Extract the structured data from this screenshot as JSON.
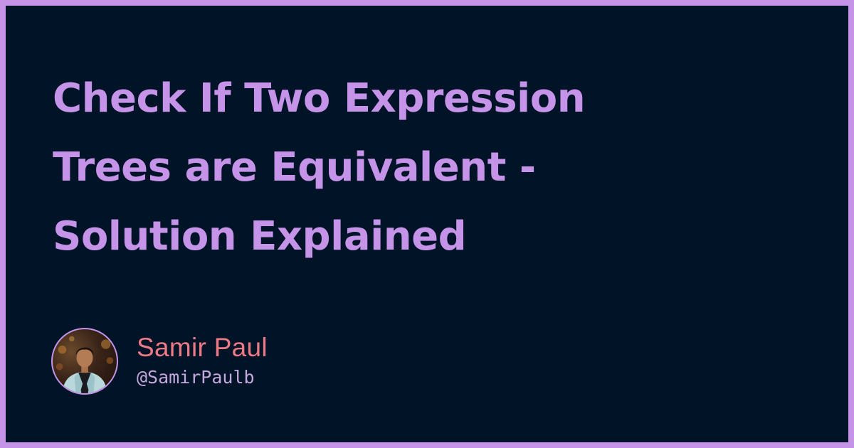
{
  "card": {
    "title_lines": [
      "Check If Two Expression",
      "Trees are Equivalent -",
      "Solution Explained"
    ]
  },
  "author": {
    "name": "Samir Paul",
    "handle": "@SamirPaulb",
    "avatar_icon": "profile-photo"
  },
  "colors": {
    "background": "#011427",
    "border": "#c593e8",
    "title": "#c593e8",
    "name": "#ec7a86",
    "handle": "#c4a8dc"
  }
}
